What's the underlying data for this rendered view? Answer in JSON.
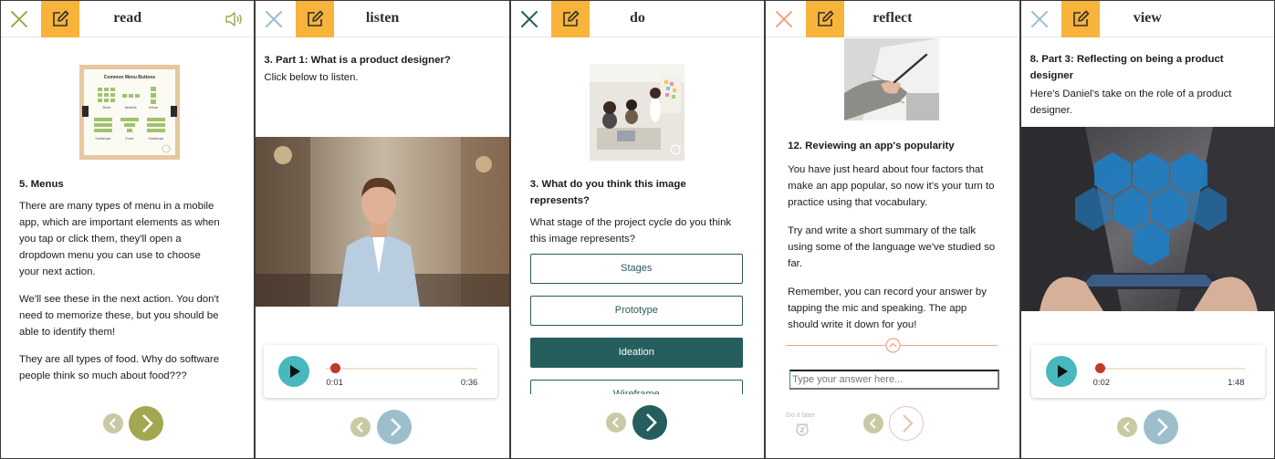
{
  "colors": {
    "accent_orange": "#f8b33a",
    "olive": "#a2a752",
    "olive_light": "#c9c9a3",
    "teal_dark": "#255e5c",
    "teal_play": "#47b8bb",
    "blue_grey": "#9dbfcc",
    "salmon": "#f0a582"
  },
  "icons": {
    "close": "close-x-icon",
    "edit": "pencil-square-icon",
    "sound": "speaker-icon",
    "play": "play-icon",
    "prev": "chevron-left-icon",
    "next": "chevron-right-icon",
    "collapse": "chevron-up-circle-icon",
    "alarm": "alarm-clock-icon"
  },
  "panels": {
    "read": {
      "title": "read",
      "image_title": "Common Menu Buttons",
      "image_labels": [
        "Bento",
        "Meatball",
        "Kebab",
        "Hamburger",
        "Doner",
        "Hamburger"
      ],
      "heading": "5. Menus",
      "p1": [
        "There are many types of menu in a mobile",
        "app, which are important elements as when",
        "you tap or click them, they'll open a",
        "dropdown menu you can use to choose",
        "your next action."
      ],
      "p2": [
        "We'll see these in the next action. You don't",
        "need to memorize these, but you should be",
        "able to identify them!"
      ],
      "p3": [
        "They are all types of food. Why do software",
        "people think so much about food???"
      ]
    },
    "listen": {
      "title": "listen",
      "heading": "3. Part 1: What is a product designer?",
      "sub": "Click below to listen.",
      "time_start": "0:01",
      "time_end": "0:36",
      "progress": 0.03
    },
    "do": {
      "title": "do",
      "question": [
        "3. What do you think this image",
        "represents?"
      ],
      "prompt": [
        "What stage of the project cycle do you think",
        "this image represents?"
      ],
      "options": [
        "Stages",
        "Prototype",
        "Ideation",
        "Wireframe"
      ],
      "selected_option": "Ideation"
    },
    "reflect": {
      "title": "reflect",
      "heading": "12. Reviewing an app's popularity",
      "p1": [
        "You have just heard about four factors that",
        "make an app popular, so now it's your turn to",
        "practice using that vocabulary."
      ],
      "p2": [
        "Try and write a short summary of the talk",
        "using some of the language we've studied so",
        "far."
      ],
      "p3": [
        "Remember, you can record your answer by",
        "tapping the mic and speaking. The app",
        "should write it down for you!"
      ],
      "answer_placeholder": "Type your answer here...",
      "do_it_later": "Do it later"
    },
    "view": {
      "title": "view",
      "heading": [
        "8. Part 3: Reflecting on being a product",
        "designer"
      ],
      "sub": [
        "Here's Daniel's take on the role of a product",
        "designer."
      ],
      "time_start": "0:02",
      "time_end": "1:48",
      "progress": 0.02
    }
  }
}
